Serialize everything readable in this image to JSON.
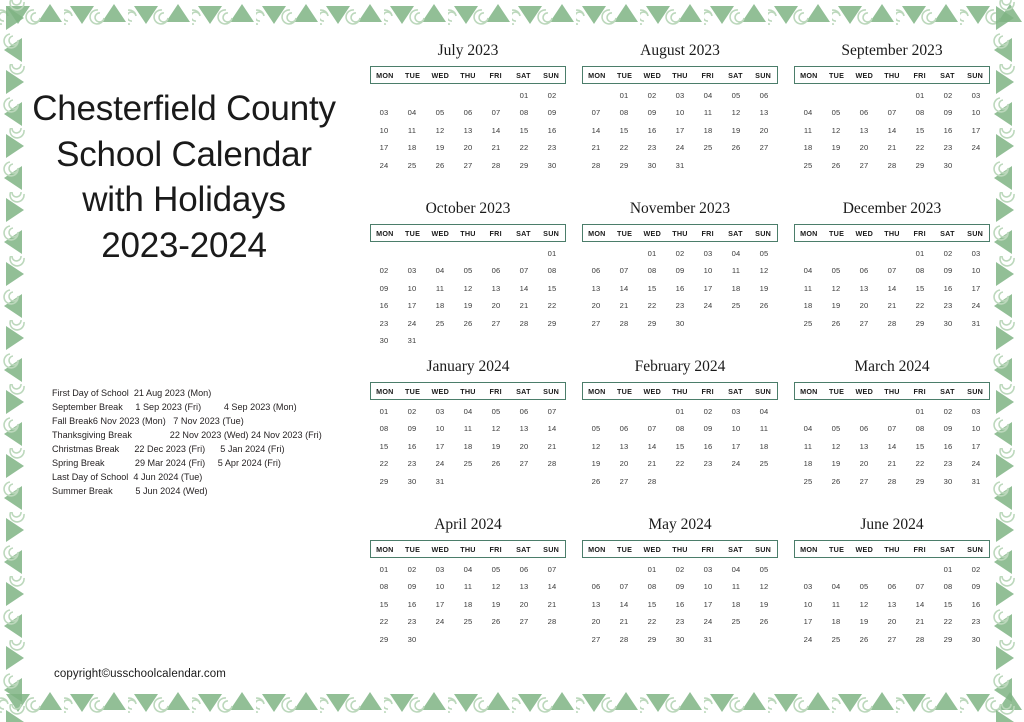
{
  "title": {
    "line1": "Chesterfield County",
    "line2": "School Calendar",
    "line3": "with Holidays",
    "line4": "2023-2024"
  },
  "copyright": "copyright©usschoolcalendar.com",
  "colors": {
    "border_accent": "#4b7d6a",
    "ornament_green": "#7fb484",
    "ornament_swirl": "#c9dfc9",
    "text": "#1a1a1a",
    "day_text": "#3a3a3a"
  },
  "holidays": [
    "First Day of School  21 Aug 2023 (Mon)",
    "September Break     1 Sep 2023 (Fri)         4 Sep 2023 (Mon)",
    "Fall Break6 Nov 2023 (Mon)   7 Nov 2023 (Tue)",
    "Thanksgiving Break               22 Nov 2023 (Wed) 24 Nov 2023 (Fri)",
    "Christmas Break      22 Dec 2023 (Fri)      5 Jan 2024 (Fri)",
    "Spring Break            29 Mar 2024 (Fri)     5 Apr 2024 (Fri)",
    "Last Day of School  4 Jun 2024 (Tue)",
    "Summer Break         5 Jun 2024 (Wed)"
  ],
  "holiday_details": [
    {
      "name": "First Day of School",
      "start": "21 Aug 2023 (Mon)",
      "end": ""
    },
    {
      "name": "September Break",
      "start": "1 Sep 2023 (Fri)",
      "end": "4 Sep 2023 (Mon)"
    },
    {
      "name": "Fall Break",
      "start": "6 Nov 2023 (Mon)",
      "end": "7 Nov 2023 (Tue)"
    },
    {
      "name": "Thanksgiving Break",
      "start": "22 Nov 2023 (Wed)",
      "end": "24 Nov 2023 (Fri)"
    },
    {
      "name": "Christmas Break",
      "start": "22 Dec 2023 (Fri)",
      "end": "5 Jan 2024 (Fri)"
    },
    {
      "name": "Spring Break",
      "start": "29 Mar 2024 (Fri)",
      "end": "5 Apr 2024 (Fri)"
    },
    {
      "name": "Last Day of School",
      "start": "4 Jun 2024 (Tue)",
      "end": ""
    },
    {
      "name": "Summer Break",
      "start": "5 Jun 2024 (Wed)",
      "end": ""
    }
  ],
  "dow_labels": [
    "MON",
    "TUE",
    "WED",
    "THU",
    "FRI",
    "SAT",
    "SUN"
  ],
  "months": [
    {
      "name": "July 2023",
      "lead_blanks": 5,
      "days": [
        "01",
        "02",
        "03",
        "04",
        "05",
        "06",
        "07",
        "08",
        "09",
        "10",
        "11",
        "12",
        "13",
        "14",
        "15",
        "16",
        "17",
        "18",
        "19",
        "20",
        "21",
        "22",
        "23",
        "24",
        "25",
        "26",
        "27",
        "28",
        "29",
        "30"
      ]
    },
    {
      "name": "August 2023",
      "lead_blanks": 1,
      "days": [
        "01",
        "02",
        "03",
        "04",
        "05",
        "06",
        "07",
        "08",
        "09",
        "10",
        "11",
        "12",
        "13",
        "14",
        "15",
        "16",
        "17",
        "18",
        "19",
        "20",
        "21",
        "22",
        "23",
        "24",
        "25",
        "26",
        "27",
        "28",
        "29",
        "30",
        "31"
      ]
    },
    {
      "name": "September 2023",
      "lead_blanks": 4,
      "days": [
        "01",
        "02",
        "03",
        "04",
        "05",
        "06",
        "07",
        "08",
        "09",
        "10",
        "11",
        "12",
        "13",
        "14",
        "15",
        "16",
        "17",
        "18",
        "19",
        "20",
        "21",
        "22",
        "23",
        "24",
        "25",
        "26",
        "27",
        "28",
        "29",
        "30"
      ]
    },
    {
      "name": "October 2023",
      "lead_blanks": 6,
      "days": [
        "01",
        "02",
        "03",
        "04",
        "05",
        "06",
        "07",
        "08",
        "09",
        "10",
        "11",
        "12",
        "13",
        "14",
        "15",
        "16",
        "17",
        "18",
        "19",
        "20",
        "21",
        "22",
        "23",
        "24",
        "25",
        "26",
        "27",
        "28",
        "29",
        "30",
        "31"
      ]
    },
    {
      "name": "November 2023",
      "lead_blanks": 2,
      "days": [
        "01",
        "02",
        "03",
        "04",
        "05",
        "06",
        "07",
        "08",
        "09",
        "10",
        "11",
        "12",
        "13",
        "14",
        "15",
        "16",
        "17",
        "18",
        "19",
        "20",
        "21",
        "22",
        "23",
        "24",
        "25",
        "26",
        "27",
        "28",
        "29",
        "30"
      ]
    },
    {
      "name": "December 2023",
      "lead_blanks": 4,
      "days": [
        "01",
        "02",
        "03",
        "04",
        "05",
        "06",
        "07",
        "08",
        "09",
        "10",
        "11",
        "12",
        "13",
        "14",
        "15",
        "16",
        "17",
        "18",
        "19",
        "20",
        "21",
        "22",
        "23",
        "24",
        "25",
        "26",
        "27",
        "28",
        "29",
        "30",
        "31"
      ]
    },
    {
      "name": "January 2024",
      "lead_blanks": 0,
      "days": [
        "01",
        "02",
        "03",
        "04",
        "05",
        "06",
        "07",
        "08",
        "09",
        "10",
        "11",
        "12",
        "13",
        "14",
        "15",
        "16",
        "17",
        "18",
        "19",
        "20",
        "21",
        "22",
        "23",
        "24",
        "25",
        "26",
        "27",
        "28",
        "29",
        "30",
        "31"
      ]
    },
    {
      "name": "February 2024",
      "lead_blanks": 3,
      "days": [
        "01",
        "02",
        "03",
        "04",
        "05",
        "06",
        "07",
        "08",
        "09",
        "10",
        "11",
        "12",
        "13",
        "14",
        "15",
        "16",
        "17",
        "18",
        "19",
        "20",
        "21",
        "22",
        "23",
        "24",
        "25",
        "26",
        "27",
        "28"
      ]
    },
    {
      "name": "March 2024",
      "lead_blanks": 4,
      "days": [
        "01",
        "02",
        "03",
        "04",
        "05",
        "06",
        "07",
        "08",
        "09",
        "10",
        "11",
        "12",
        "13",
        "14",
        "15",
        "16",
        "17",
        "18",
        "19",
        "20",
        "21",
        "22",
        "23",
        "24",
        "25",
        "26",
        "27",
        "28",
        "29",
        "30",
        "31"
      ]
    },
    {
      "name": "April 2024",
      "lead_blanks": 0,
      "days": [
        "01",
        "02",
        "03",
        "04",
        "05",
        "06",
        "07",
        "08",
        "09",
        "10",
        "11",
        "12",
        "13",
        "14",
        "15",
        "16",
        "17",
        "18",
        "19",
        "20",
        "21",
        "22",
        "23",
        "24",
        "25",
        "26",
        "27",
        "28",
        "29",
        "30"
      ]
    },
    {
      "name": "May 2024",
      "lead_blanks": 2,
      "days": [
        "01",
        "02",
        "03",
        "04",
        "05",
        "06",
        "07",
        "08",
        "09",
        "10",
        "11",
        "12",
        "13",
        "14",
        "15",
        "16",
        "17",
        "18",
        "19",
        "20",
        "21",
        "22",
        "23",
        "24",
        "25",
        "26",
        "27",
        "28",
        "29",
        "30",
        "31"
      ]
    },
    {
      "name": "June 2024",
      "lead_blanks": 5,
      "days": [
        "01",
        "02",
        "03",
        "04",
        "05",
        "06",
        "07",
        "08",
        "09",
        "10",
        "11",
        "12",
        "13",
        "14",
        "15",
        "16",
        "17",
        "18",
        "19",
        "20",
        "21",
        "22",
        "23",
        "24",
        "25",
        "26",
        "27",
        "28",
        "29",
        "30"
      ]
    }
  ]
}
